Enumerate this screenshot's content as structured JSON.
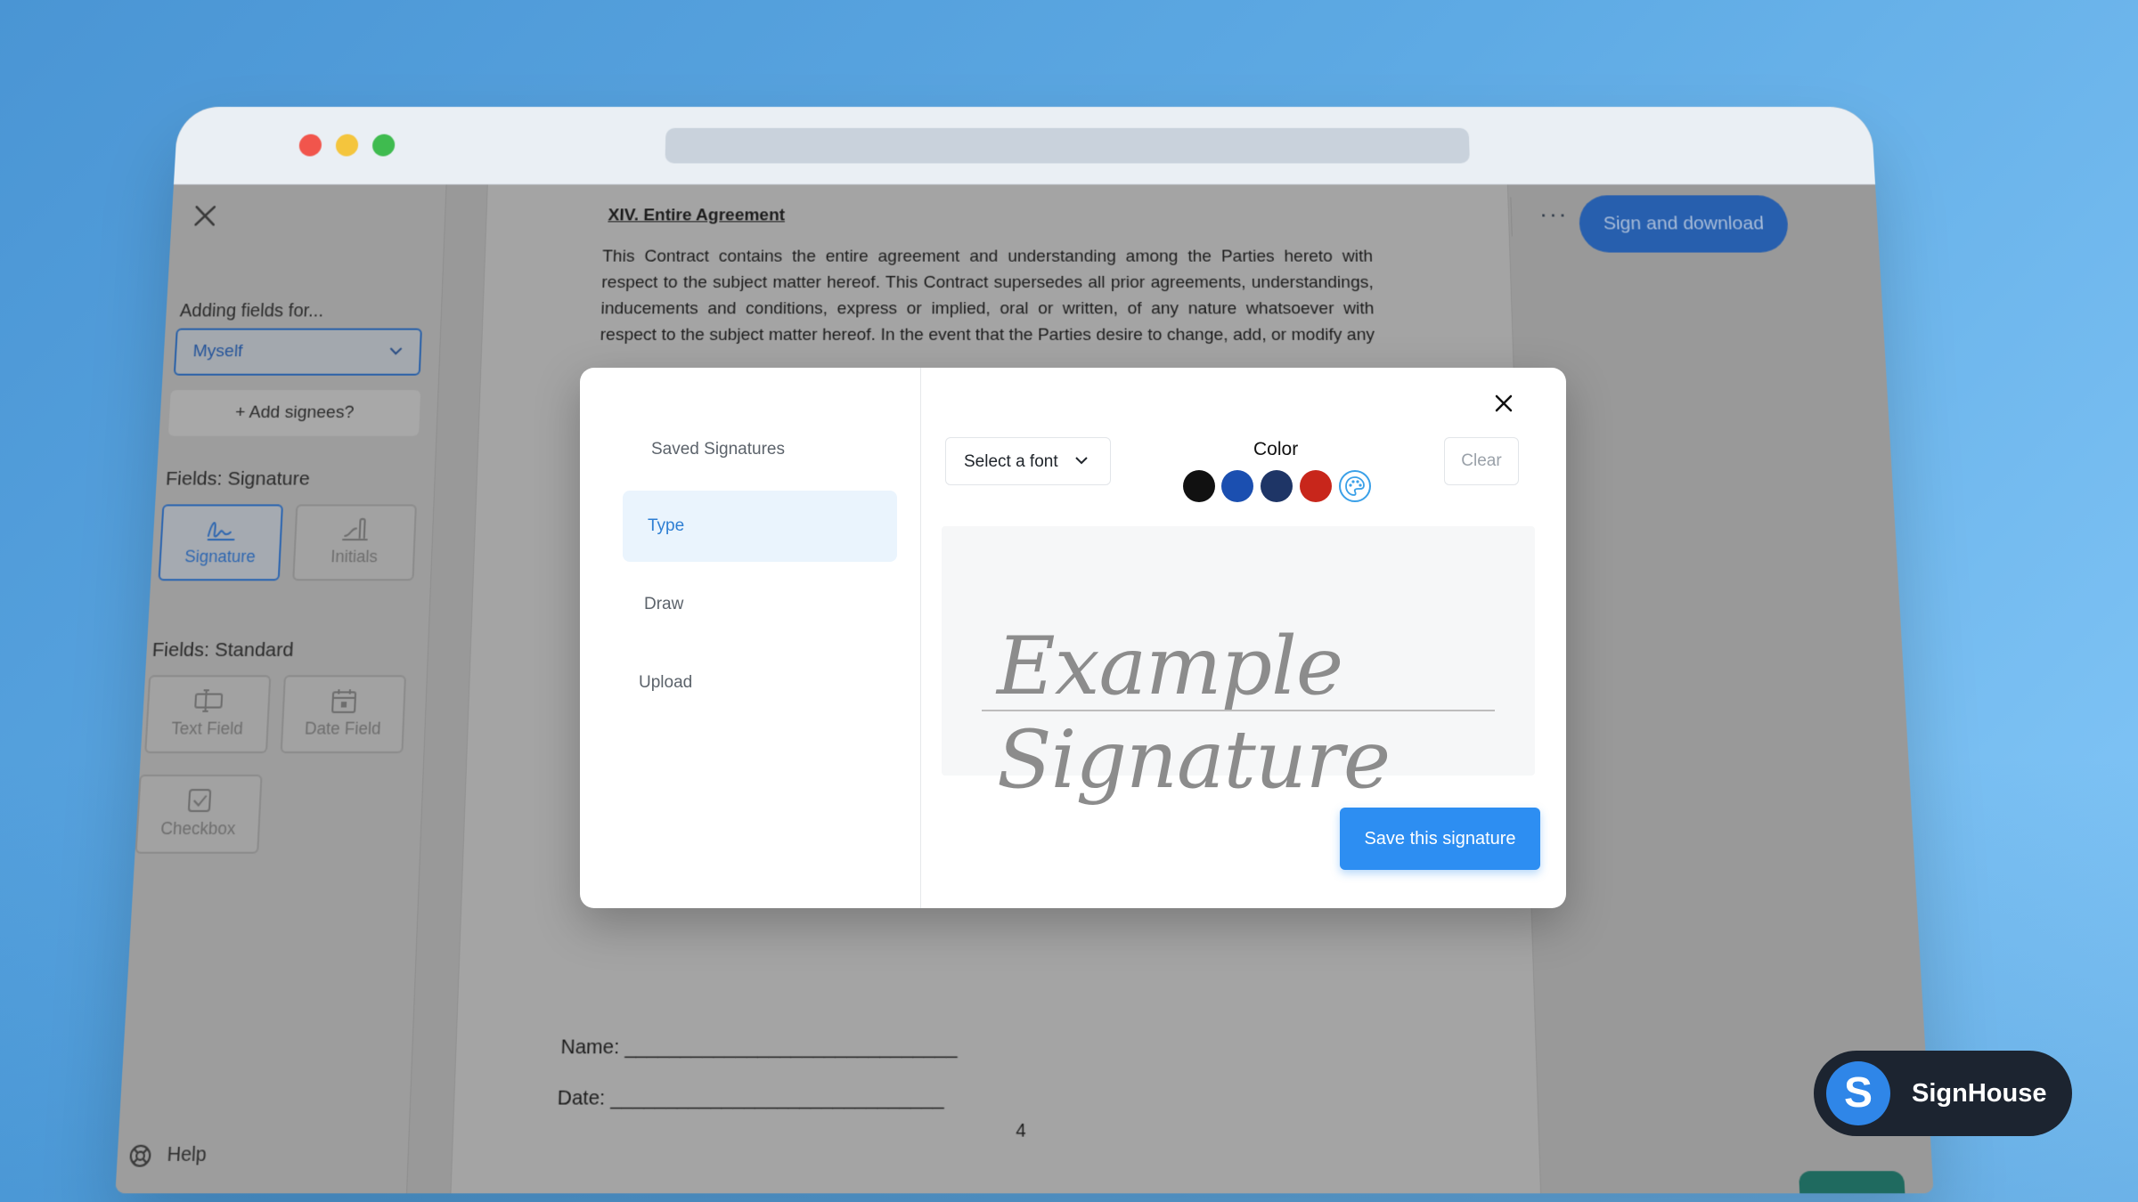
{
  "sidebar": {
    "adding_label": "Adding fields for...",
    "signee_value": "Myself",
    "add_signees": "+ Add signees?",
    "signature_section": "Fields: Signature",
    "signature_fields": [
      "Signature",
      "Initials"
    ],
    "standard_section": "Fields: Standard",
    "standard_fields": [
      "Text Field",
      "Date Field",
      "Checkbox"
    ],
    "help": "Help"
  },
  "document": {
    "section_title": "XIV. Entire Agreement",
    "body": "This Contract contains the entire agreement and understanding among the Parties hereto with respect to the subject matter hereof. This Contract supersedes all prior agreements, understandings, inducements and conditions, express or implied, oral or written, of any nature whatsoever with respect to the subject matter hereof. In the event that the Parties desire to change, add, or modify any of the terms agreed upon in this Contract, they shall do so in writing",
    "name_line": "Name: ______________________________",
    "date_line": "Date: ______________________________",
    "page_number": "4"
  },
  "toolbar": {
    "more": "···",
    "sign_and_download": "Sign and download"
  },
  "modal": {
    "tabs": [
      "Saved Signatures",
      "Type",
      "Draw",
      "Upload"
    ],
    "active_tab": "Type",
    "font_select": "Select a font",
    "color_label": "Color",
    "colors": [
      "#111111",
      "#1b4fb0",
      "#1e3566",
      "#c8261b"
    ],
    "clear": "Clear",
    "signature_preview": "Example Signature",
    "save": "Save this signature"
  },
  "brand": {
    "logo_letter": "S",
    "name": "SignHouse"
  }
}
